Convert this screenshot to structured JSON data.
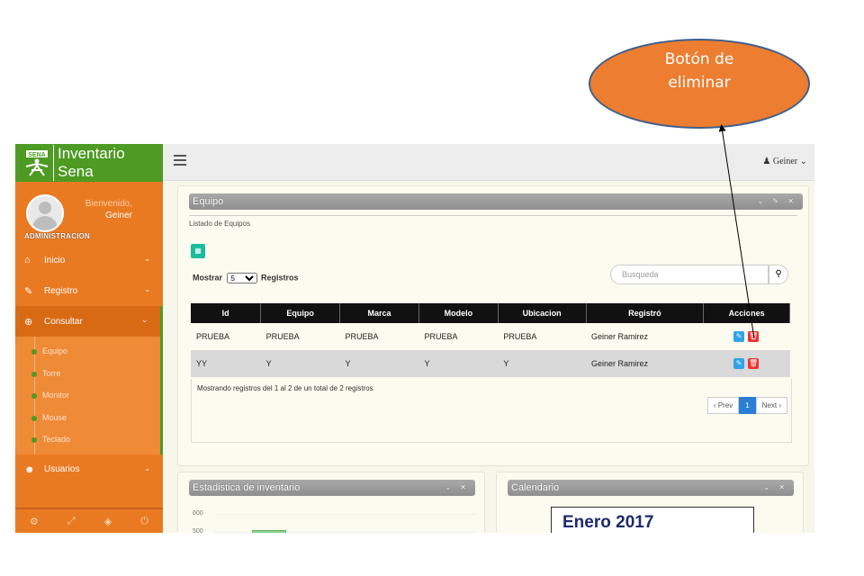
{
  "annotation": {
    "line1": "Botón de",
    "line2": "eliminar"
  },
  "sidebar": {
    "brand": "Inventario Sena",
    "welcome": "Bienvenido,",
    "user_name": "Geiner",
    "role": "ADMINISTRACION",
    "items": [
      {
        "label": "Inicio",
        "icon": "home-icon"
      },
      {
        "label": "Registro",
        "icon": "edit-icon"
      },
      {
        "label": "Consultar",
        "icon": "search-plus-icon"
      },
      {
        "label": "Usuarios",
        "icon": "users-icon"
      }
    ],
    "subitems": [
      "Equipo",
      "Torre",
      "Monitor",
      "Mouse",
      "Teclado"
    ]
  },
  "topnav": {
    "user": "Geiner"
  },
  "panel": {
    "title": "Equipo",
    "subtitle": "Listado de Equipos",
    "show_label": "Mostrar",
    "show_value": "5",
    "records_label": "Registros",
    "search_placeholder": "Busqueda"
  },
  "table": {
    "headers": [
      "Id",
      "Equipo",
      "Marca",
      "Modelo",
      "Ubicacion",
      "Registró",
      "Acciones"
    ],
    "rows": [
      [
        "PRUEBA",
        "PRUEBA",
        "PRUEBA",
        "PRUEBA",
        "PRUEBA",
        "Geiner Ramirez"
      ],
      [
        "YY",
        "Y",
        "Y",
        "Y",
        "Y",
        "Geiner Ramirez"
      ]
    ]
  },
  "footer": {
    "info": "Mostrando registros del 1 al 2 de un total de 2 registros",
    "prev": "‹ Prev",
    "page": "1",
    "next": "Next ›"
  },
  "stats": {
    "title": "Estadistica de inventario",
    "y_labels": [
      "600",
      "500"
    ]
  },
  "calendar": {
    "title": "Calendario",
    "month": "Enero 2017"
  },
  "colors": {
    "sidebar": "#ea7a22",
    "brand": "#4d9b22",
    "delete": "#e33333",
    "edit": "#2fa4e7",
    "bubble": "#ed7d31"
  }
}
